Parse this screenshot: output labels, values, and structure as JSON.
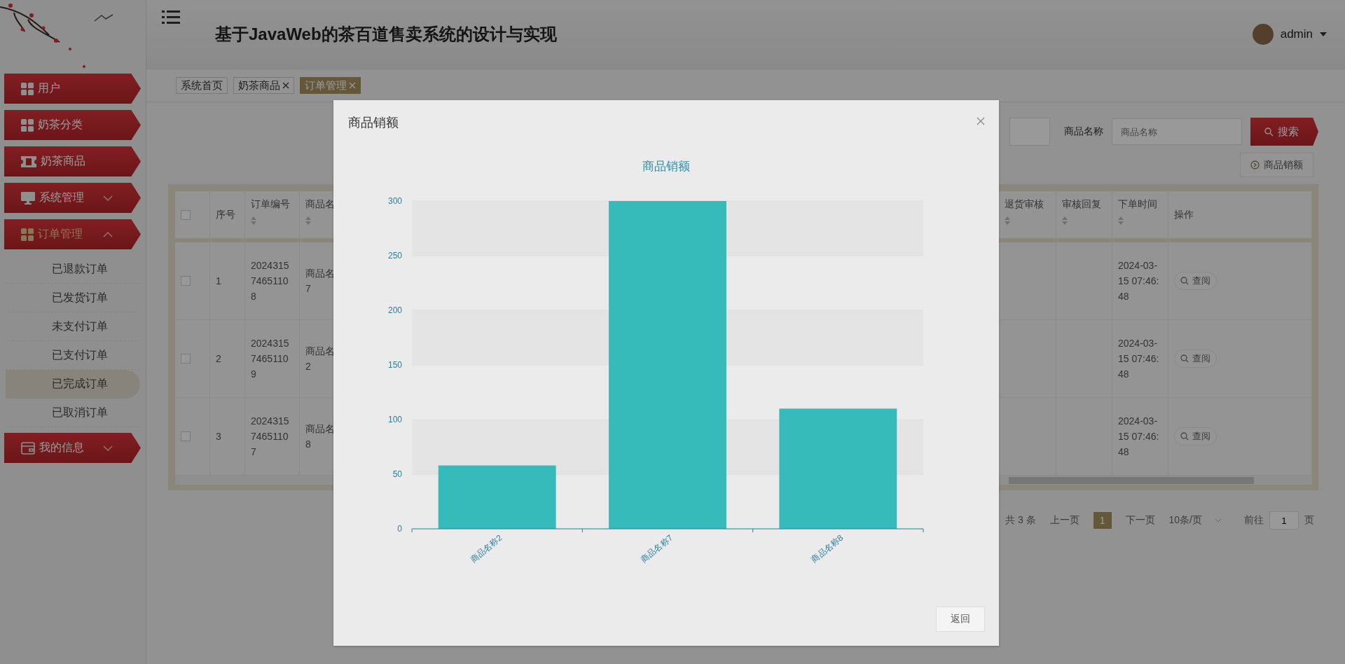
{
  "header": {
    "title": "基于JavaWeb的茶百道售卖系统的设计与实现",
    "user": "admin"
  },
  "sidebar": {
    "items": [
      {
        "label": "用户",
        "kind": "link"
      },
      {
        "label": "奶茶分类",
        "kind": "link"
      },
      {
        "label": "奶茶商品",
        "kind": "link"
      },
      {
        "label": "系统管理",
        "kind": "group",
        "expanded": false
      },
      {
        "label": "订单管理",
        "kind": "group",
        "expanded": true,
        "children": [
          {
            "label": "已退款订单",
            "selected": false
          },
          {
            "label": "已发货订单",
            "selected": false
          },
          {
            "label": "未支付订单",
            "selected": false
          },
          {
            "label": "已支付订单",
            "selected": false
          },
          {
            "label": "已完成订单",
            "selected": true
          },
          {
            "label": "已取消订单",
            "selected": false
          }
        ]
      },
      {
        "label": "我的信息",
        "kind": "group",
        "expanded": false
      }
    ]
  },
  "tabs": [
    {
      "label": "系统首页",
      "closable": false,
      "selected": false
    },
    {
      "label": "奶茶商品",
      "closable": true,
      "selected": false
    },
    {
      "label": "订单管理",
      "closable": true,
      "selected": true
    }
  ],
  "search": {
    "fields": [
      {
        "label": "商品名称",
        "placeholder": "商品名称"
      }
    ],
    "search_button": "搜索",
    "chart_button": "商品销额"
  },
  "table": {
    "select_all": {
      "checked": false
    },
    "columns": [
      {
        "kind": "text",
        "label": "序号",
        "sortable": false
      },
      {
        "kind": "text",
        "label": "订单编号",
        "sortable": true
      },
      {
        "kind": "text",
        "label": "商品名",
        "sortable": true
      },
      {
        "kind": "text",
        "label": "退货审核",
        "sortable": true
      },
      {
        "kind": "text",
        "label": "审核回复",
        "sortable": true
      },
      {
        "kind": "text",
        "label": "下单时间",
        "sortable": true
      },
      {
        "kind": "action",
        "label": "操作",
        "sortable": false
      }
    ],
    "rows": [
      {
        "checked": false,
        "cells": [
          "1",
          "202431574651108",
          "商品名\n7",
          "",
          "",
          "2024-03-15 07:46:48",
          "查阅"
        ]
      },
      {
        "checked": false,
        "cells": [
          "2",
          "202431574651109",
          "商品名\n2",
          "",
          "",
          "2024-03-15 07:46:48",
          "查阅"
        ]
      },
      {
        "checked": false,
        "cells": [
          "3",
          "202431574651107",
          "商品名\n8",
          "",
          "",
          "2024-03-15 07:46:48",
          "查阅"
        ]
      }
    ]
  },
  "pager": {
    "total": "共 3 条",
    "prev": "上一页",
    "pages": [
      {
        "label": "1",
        "selected": true
      }
    ],
    "next": "下一页",
    "page_size": "10条/页",
    "goto_label": "前往",
    "goto_value": "1",
    "goto_suffix": "页"
  },
  "modal": {
    "title": "商品销额",
    "back_button": "返回",
    "chart_data": {
      "type": "bar",
      "title": "商品销额",
      "grid": true,
      "categories": [
        "商品名称2",
        "商品名称7",
        "商品名称8"
      ],
      "series": [
        {
          "color": "#36baba",
          "values": [
            58,
            300,
            110
          ]
        }
      ],
      "ylim": [
        0,
        300
      ],
      "yticks": [
        0,
        50,
        100,
        150,
        200,
        250,
        300
      ]
    }
  }
}
